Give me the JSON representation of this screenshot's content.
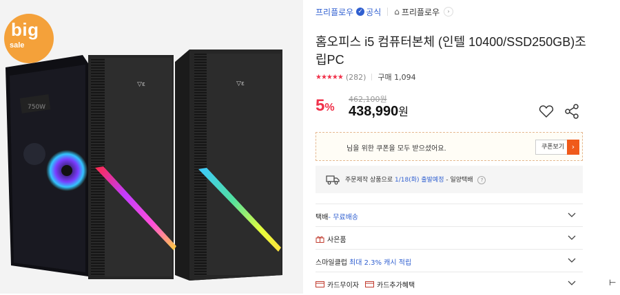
{
  "badge": {
    "line1": "big",
    "line2": "sale"
  },
  "store": {
    "brand": "프리플로우",
    "official_label": "공식",
    "store_name": "프리플로우"
  },
  "product": {
    "title": "홈오피스 i5 컴퓨터본체 (인텔 10400/SSD250GB)조립PC",
    "stars": "★★★★★",
    "review_count": "(282)",
    "purchase_count": "구매 1,094",
    "original_price": "462,100원",
    "discount_value": "5",
    "discount_unit": "%",
    "price": "438,990",
    "price_unit": "원"
  },
  "coupon": {
    "message": "님을 위한 쿠폰을 모두 받으셨어요.",
    "button_label": "쿠폰보기"
  },
  "shipping": {
    "prefix": "주문제작 상품으로",
    "date": "1/18(화) 출발예정",
    "suffix": " - 일양택배"
  },
  "options": [
    {
      "label": "택배",
      "value": " - 무료배송"
    },
    {
      "label": "사은품",
      "value": ""
    },
    {
      "label": "스마일클럽",
      "value": "최대 2.3% 캐시 적립"
    },
    {
      "label": "카드무이자",
      "value": "카드추가혜택"
    }
  ],
  "colors": {
    "accent_red": "#f0314a",
    "brand_blue": "#2f5fd0",
    "coupon_orange": "#f05a1a"
  }
}
